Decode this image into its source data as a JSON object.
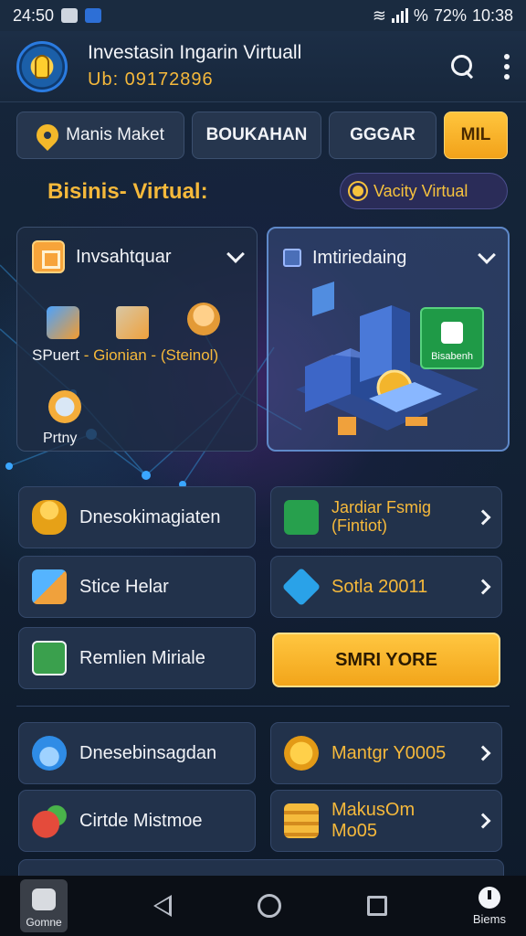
{
  "status_bar": {
    "time": "24:50",
    "signal_text": "%",
    "battery": "72%",
    "clock": "10:38"
  },
  "header": {
    "title": "Investasin Ingarin Virtuall",
    "subtitle": "Ub: 09172896",
    "icons": [
      "lightbulb-logo",
      "search-icon",
      "more-vert-icon"
    ]
  },
  "tabs": [
    {
      "label": "Manis Maket",
      "icon": "location-pin-icon"
    },
    {
      "label": "BOUKAHAN"
    },
    {
      "label": "GGGAR"
    },
    {
      "label": "MIL",
      "active": true
    }
  ],
  "section": {
    "title": "Bisinis- Virtual:",
    "chip": "Vacity Virtual"
  },
  "card_left": {
    "title": "Invsahtquar",
    "items": [
      "SPuert",
      "Gionian",
      "(Steinol)"
    ],
    "separator": " - ",
    "last_item": "Prtny"
  },
  "card_right": {
    "title": "Imtiriedaing",
    "badge": "Bisabenh"
  },
  "list_left": [
    {
      "label": "Dnesokimagiaten",
      "icon": "coins-icon"
    },
    {
      "label": "Stice Helar",
      "icon": "store-icon"
    },
    {
      "label": "Remlien Miriale",
      "icon": "leaf-icon"
    }
  ],
  "list_right": [
    {
      "line1": "Jardiar Fsmig",
      "line2": "(Fintiot)",
      "icon": "growth-icon"
    },
    {
      "label": "Sotla 20011",
      "icon": "diamond-icon"
    }
  ],
  "cta_label": "SMRI YORE",
  "list2_left": [
    {
      "label": "Dnesebinsagdan",
      "icon": "drop-icon"
    },
    {
      "label": "Cirtde Mistmoe",
      "icon": "fruit-icon"
    }
  ],
  "list2_right": [
    {
      "label": "Mantgr Y0005",
      "icon": "coin-icon"
    },
    {
      "label": "MakusOm Mo05",
      "icon": "stack-icon"
    }
  ],
  "nav": {
    "home_label": "Gomne",
    "right_label": "Biems"
  },
  "colors": {
    "accent": "#f6b93b",
    "background": "#132236",
    "card": "#22324b"
  }
}
